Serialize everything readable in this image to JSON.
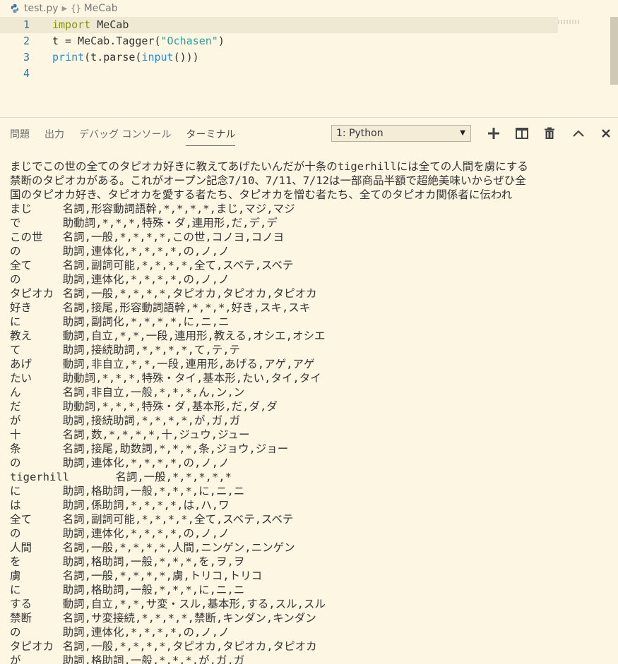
{
  "breadcrumb": {
    "file": "test.py",
    "symbol": "MeCab"
  },
  "editor": {
    "lines": [
      {
        "num": "1",
        "kw": "import",
        "rest": " MeCab"
      },
      {
        "num": "2",
        "pre": "t = MeCab.Tagger(",
        "str": "\"Ochasen\"",
        "post": ")"
      },
      {
        "num": "3",
        "fn": "print",
        "mid": "(t.parse(",
        "fn2": "input",
        "post": "()))"
      },
      {
        "num": "4"
      }
    ]
  },
  "panel": {
    "tabs": [
      "問題",
      "出力",
      "デバッグ コンソール",
      "ターミナル"
    ],
    "active_tab": "ターミナル",
    "terminal_select": "1: Python"
  },
  "terminal": {
    "lines": [
      "まじでこの世の全てのタピオカ好きに教えてあげたいんだが十条のtigerhillには全ての人間を虜にする",
      "禁断のタピオカがある。これがオープン記念7/10、7/11、7/12は一部商品半額で超絶美味いからぜひ全",
      "国のタピオカ好き、タピオカを愛する者たち、タピオカを憎む者たち、全てのタピオカ関係者に伝われ",
      "まじ\t名詞,形容動詞語幹,*,*,*,*,まじ,マジ,マジ",
      "で\t助動詞,*,*,*,特殊・ダ,連用形,だ,デ,デ",
      "この世\t名詞,一般,*,*,*,*,この世,コノヨ,コノヨ",
      "の\t助詞,連体化,*,*,*,*,の,ノ,ノ",
      "全て\t名詞,副詞可能,*,*,*,*,全て,スベテ,スベテ",
      "の\t助詞,連体化,*,*,*,*,の,ノ,ノ",
      "タピオカ\t名詞,一般,*,*,*,*,タピオカ,タピオカ,タピオカ",
      "好き\t名詞,接尾,形容動詞語幹,*,*,*,好き,スキ,スキ",
      "に\t助詞,副詞化,*,*,*,*,に,ニ,ニ",
      "教え\t動詞,自立,*,*,一段,連用形,教える,オシエ,オシエ",
      "て\t助詞,接続助詞,*,*,*,*,て,テ,テ",
      "あげ\t動詞,非自立,*,*,一段,連用形,あげる,アゲ,アゲ",
      "たい\t助動詞,*,*,*,特殊・タイ,基本形,たい,タイ,タイ",
      "ん\t名詞,非自立,一般,*,*,*,ん,ン,ン",
      "だ\t助動詞,*,*,*,特殊・ダ,基本形,だ,ダ,ダ",
      "が\t助詞,接続助詞,*,*,*,*,が,ガ,ガ",
      "十\t名詞,数,*,*,*,*,十,ジュウ,ジュー",
      "条\t名詞,接尾,助数詞,*,*,*,条,ジョウ,ジョー",
      "の\t助詞,連体化,*,*,*,*,の,ノ,ノ",
      "tigerhill\t名詞,一般,*,*,*,*,*",
      "に\t助詞,格助詞,一般,*,*,*,に,ニ,ニ",
      "は\t助詞,係助詞,*,*,*,*,は,ハ,ワ",
      "全て\t名詞,副詞可能,*,*,*,*,全て,スベテ,スベテ",
      "の\t助詞,連体化,*,*,*,*,の,ノ,ノ",
      "人間\t名詞,一般,*,*,*,*,人間,ニンゲン,ニンゲン",
      "を\t助詞,格助詞,一般,*,*,*,を,ヲ,ヲ",
      "虜\t名詞,一般,*,*,*,*,虜,トリコ,トリコ",
      "に\t助詞,格助詞,一般,*,*,*,に,ニ,ニ",
      "する\t動詞,自立,*,*,サ変・スル,基本形,する,スル,スル",
      "禁断\t名詞,サ変接続,*,*,*,*,禁断,キンダン,キンダン",
      "の\t助詞,連体化,*,*,*,*,の,ノ,ノ",
      "タピオカ\t名詞,一般,*,*,*,*,タピオカ,タピオカ,タピオカ",
      "が\t助詞,格助詞,一般,*,*,*,が,ガ,ガ"
    ]
  },
  "colors": {
    "background": "#fdf6e3",
    "keyword": "#859900",
    "string": "#2aa198",
    "builtin": "#268bd2",
    "line_number": "#237893"
  },
  "icons": {
    "file": "python-icon",
    "add": "plus-icon",
    "split": "split-terminal-icon",
    "kill": "trash-icon",
    "maximize": "chevron-up-icon",
    "close": "close-icon"
  }
}
